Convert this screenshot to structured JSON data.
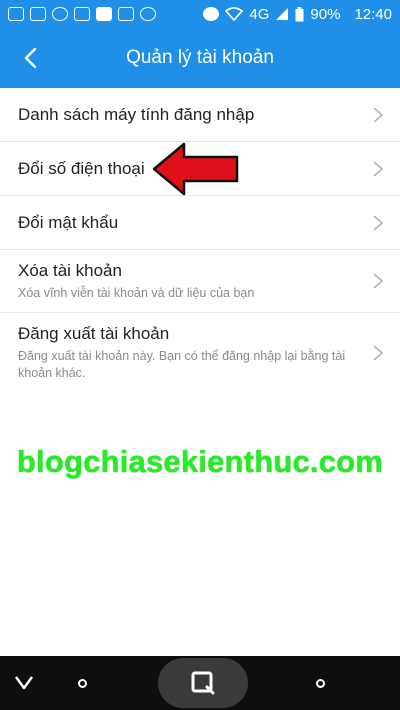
{
  "status_bar": {
    "network": "4G",
    "battery": "90%",
    "time": "12:40"
  },
  "header": {
    "title": "Quản lý tài khoản"
  },
  "menu": [
    {
      "title": "Danh sách máy tính đăng nhập",
      "subtitle": ""
    },
    {
      "title": "Đổi số điện thoại",
      "subtitle": ""
    },
    {
      "title": "Đổi mật khẩu",
      "subtitle": ""
    },
    {
      "title": "Xóa tài khoản",
      "subtitle": "Xóa vĩnh viễn tài khoản và dữ liệu của bạn"
    },
    {
      "title": "Đăng xuất tài khoản",
      "subtitle": "Đăng xuất tài khoản này. Bạn có thể đăng nhập lại bằng tài khoản khác."
    }
  ],
  "watermark": "blogchiasekienthuc.com",
  "colors": {
    "header_bg": "#1f8fe8",
    "annotation_arrow": "#e0101a",
    "watermark": "#22ee22"
  },
  "icons": {
    "back": "chevron-left-icon",
    "row": "chevron-right-icon"
  }
}
